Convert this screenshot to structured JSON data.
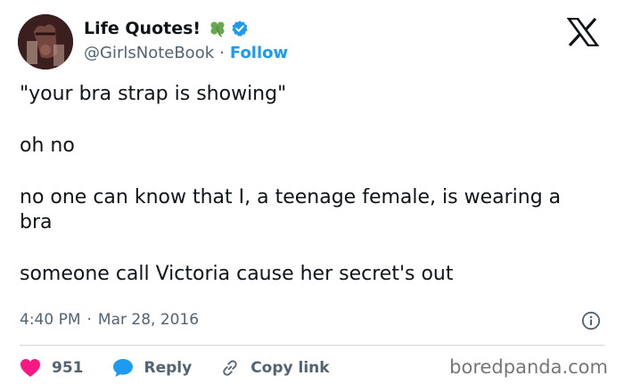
{
  "author": {
    "display_name": "Life Quotes!",
    "handle": "@GirlsNoteBook",
    "separator": "·",
    "follow_label": "Follow",
    "emoji_icon": "four-leaf-clover-icon",
    "verified_icon": "verified-badge-icon"
  },
  "tweet": {
    "paragraphs": [
      "\"your bra strap is showing\"",
      "oh no",
      "no one can know that I, a teenage female, is wearing a bra",
      "someone call Victoria cause her secret's out"
    ]
  },
  "meta": {
    "time": "4:40 PM",
    "separator": "·",
    "date": "Mar 28, 2016"
  },
  "actions": {
    "like_count": "951",
    "reply_label": "Reply",
    "copy_link_label": "Copy link"
  },
  "watermark": "boredpanda.com",
  "colors": {
    "text": "#0f1419",
    "secondary": "#536471",
    "accent_blue": "#1d9bf0",
    "like_pink": "#f91880",
    "divider": "#cfd9de",
    "clover_green": "#6aa84f"
  }
}
